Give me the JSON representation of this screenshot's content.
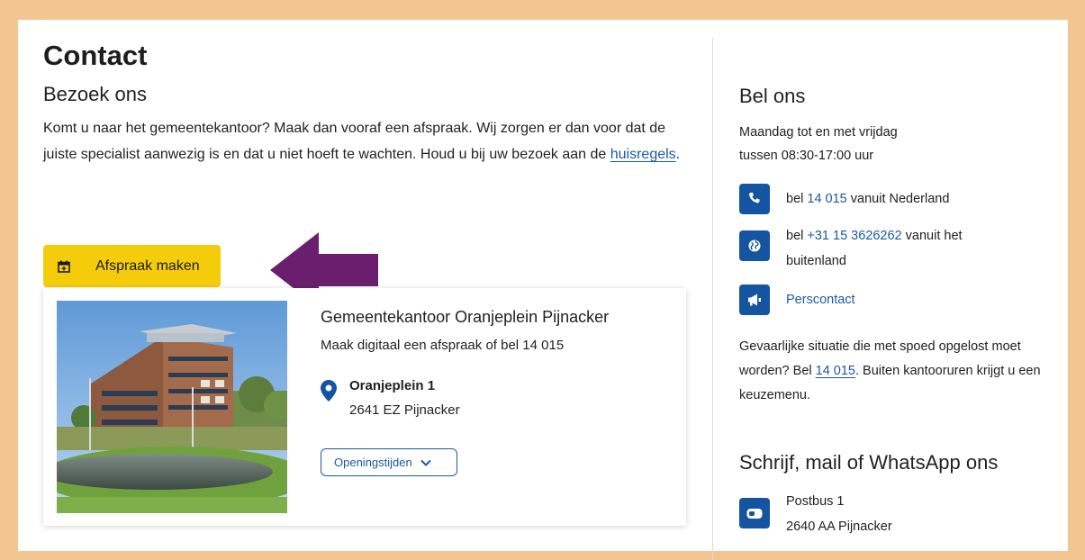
{
  "page": {
    "title": "Contact",
    "visit_heading": "Bezoek ons",
    "intro_text": "Komt u naar het gemeentekantoor? Maak dan vooraf een afspraak. Wij zorgen er dan voor dat de juiste specialist aanwezig is en dat u niet hoeft te wachten. Houd u bij uw bezoek aan de ",
    "intro_link": "huisregels",
    "intro_end": "."
  },
  "appointment_button": {
    "label": "Afspraak maken",
    "icon": "calendar-plus-icon",
    "color": "#f5cc09"
  },
  "annotation": {
    "icon": "arrow-left-icon",
    "color": "#6a1f6e"
  },
  "location": {
    "name": "Gemeentekantoor Oranjeplein Pijnacker",
    "subtitle": "Maak digitaal een afspraak of bel 14 015",
    "street": "Oranjeplein 1",
    "city": "2641 EZ Pijnacker",
    "hours_button": "Openingstijden"
  },
  "call": {
    "heading": "Bel ons",
    "hours_line1": "Maandag tot en met vrijdag",
    "hours_line2": "tussen 08:30-17:00 uur",
    "nl_pre": "bel ",
    "nl_number": "14 015",
    "nl_post": " vanuit Nederland",
    "intl_pre": "bel ",
    "intl_number": "+31 15 3626262",
    "intl_post": " vanuit het",
    "intl_line2": "buitenland",
    "press_label": "Perscontact",
    "emergency_pre": "Gevaarlijke situatie die met spoed opgelost moet worden? Bel ",
    "emergency_number": "14 015",
    "emergency_post": ". Buiten kantooruren krijgt u een keuzemenu."
  },
  "write": {
    "heading": "Schrijf, mail of WhatsApp ons",
    "postbus": "Postbus 1",
    "postcode": "2640 AA Pijnacker"
  },
  "colors": {
    "brand_blue": "#1454a0",
    "link": "#1c5aa3",
    "frame": "#f3c58f"
  }
}
